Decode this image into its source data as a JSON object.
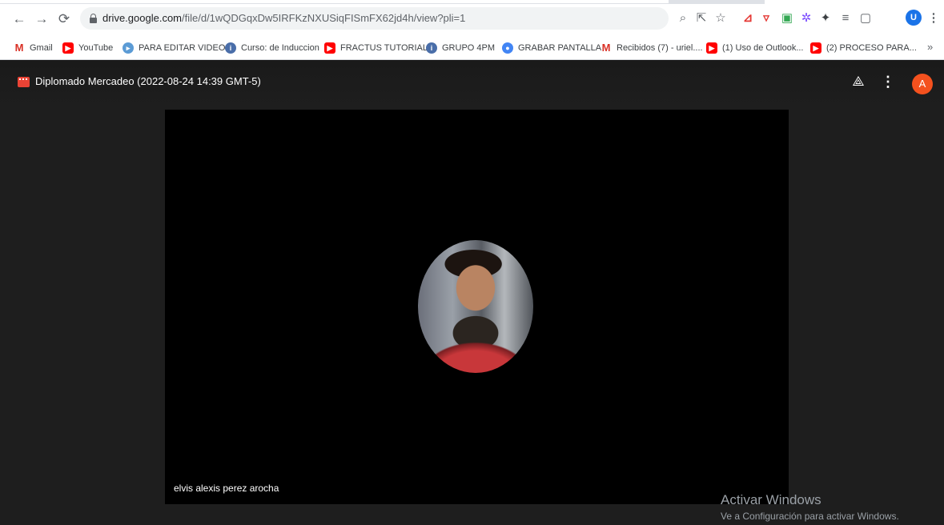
{
  "browser": {
    "url_host": "drive.google.com",
    "url_path": "/file/d/1wQDGqxDw5IRFKzNXUSiqFISmFX62jd4h/view?pli=1",
    "profile_initial": "U",
    "icons": [
      "back-icon",
      "forward-icon",
      "reload-icon",
      "lock-icon",
      "zoom-icon",
      "share-icon",
      "star-icon",
      "extensions-icon",
      "reading-list-icon",
      "side-panel-icon",
      "menu-icon"
    ]
  },
  "bookmarks": [
    {
      "label": "Gmail",
      "icon": "gmail-icon"
    },
    {
      "label": "YouTube",
      "icon": "youtube-icon"
    },
    {
      "label": "PARA EDITAR VIDEO",
      "icon": "editor-icon"
    },
    {
      "label": "Curso: de Induccion",
      "icon": "course-icon"
    },
    {
      "label": "FRACTUS TUTORIAL",
      "icon": "youtube-icon"
    },
    {
      "label": "GRUPO 4PM",
      "icon": "group-icon"
    },
    {
      "label": "GRABAR PANTALLA",
      "icon": "screen-record-icon"
    },
    {
      "label": "Recibidos (7) - uriel....",
      "icon": "gmail-icon"
    },
    {
      "label": "(1) Uso de Outlook...",
      "icon": "youtube-icon"
    },
    {
      "label": "(2) PROCESO PARA...",
      "icon": "youtube-icon"
    }
  ],
  "bookmarks_more": "»",
  "viewer": {
    "title": "Diplomado Mercadeo (2022-08-24 14:39 GMT-5)",
    "account_initial": "A",
    "participant_name": "elvis alexis perez arocha"
  },
  "watermark": {
    "line1": "Activar Windows",
    "line2": "Ve a Configuración para activar Windows."
  }
}
